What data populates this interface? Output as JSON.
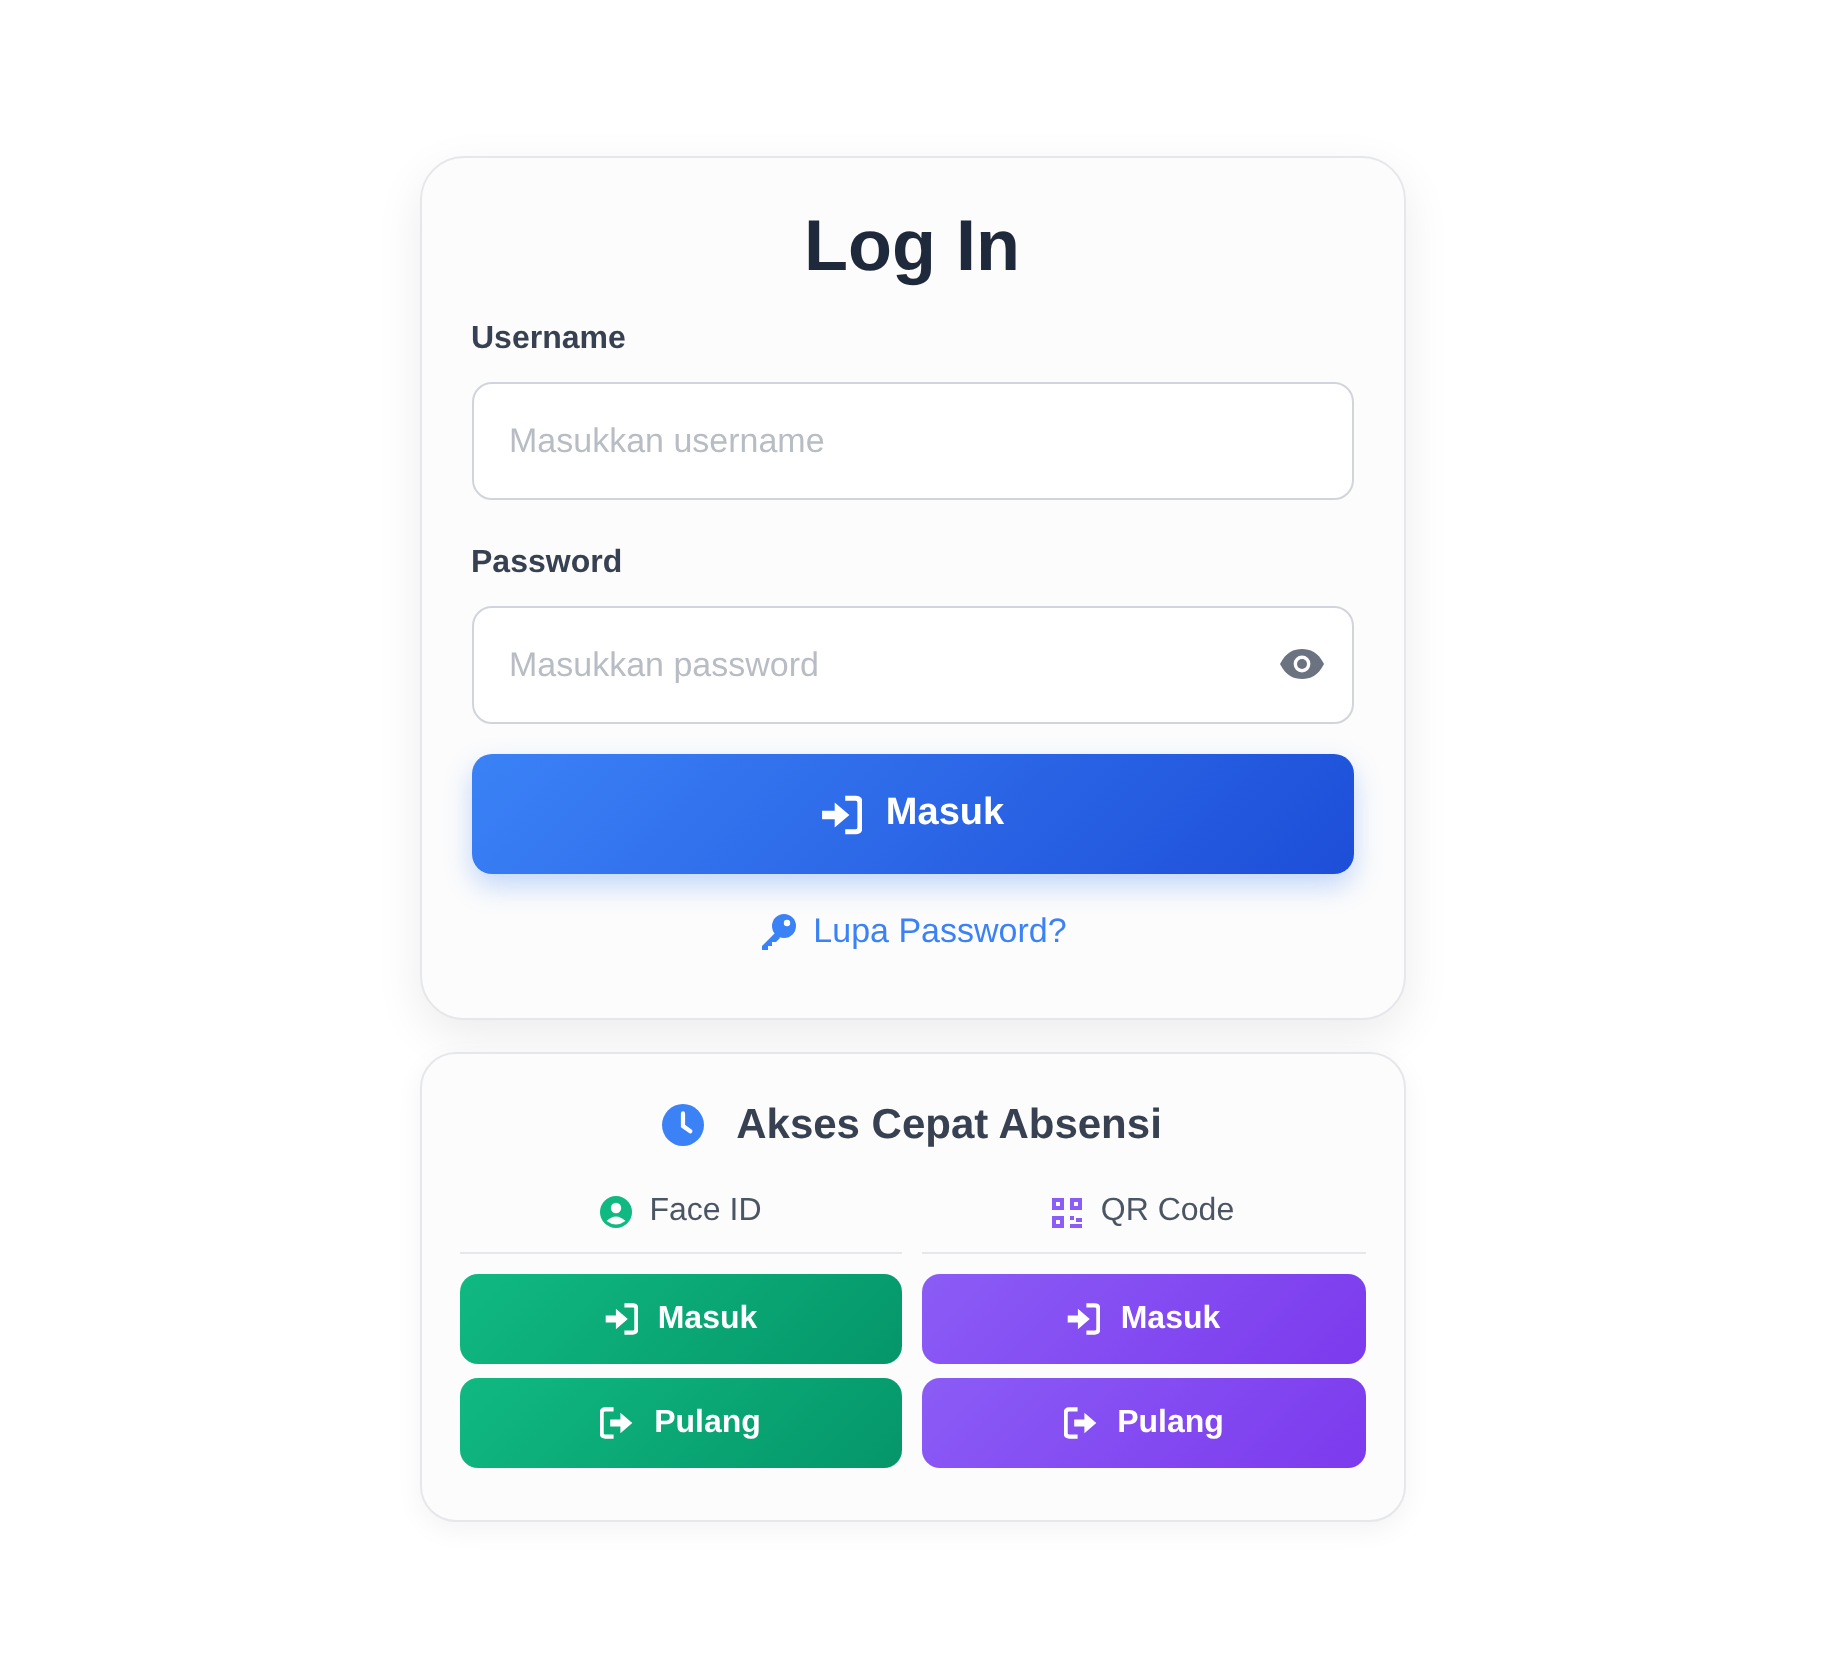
{
  "login": {
    "title": "Log In",
    "fields": [
      {
        "kind": "text",
        "label": "Username",
        "placeholder": "Masukkan username"
      },
      {
        "kind": "password",
        "label": "Password",
        "placeholder": "Masukkan password"
      }
    ],
    "submit": "Masuk",
    "forgot": "Lupa Password?"
  },
  "quick_access": {
    "title": "Akses Cepat Absensi",
    "columns": [
      {
        "kind": "face",
        "label": "Face ID",
        "buttons": [
          {
            "kind": "in",
            "label": "Masuk"
          },
          {
            "kind": "out",
            "label": "Pulang"
          }
        ]
      },
      {
        "kind": "qr",
        "label": "QR Code",
        "buttons": [
          {
            "kind": "in",
            "label": "Masuk"
          },
          {
            "kind": "out",
            "label": "Pulang"
          }
        ]
      }
    ]
  }
}
